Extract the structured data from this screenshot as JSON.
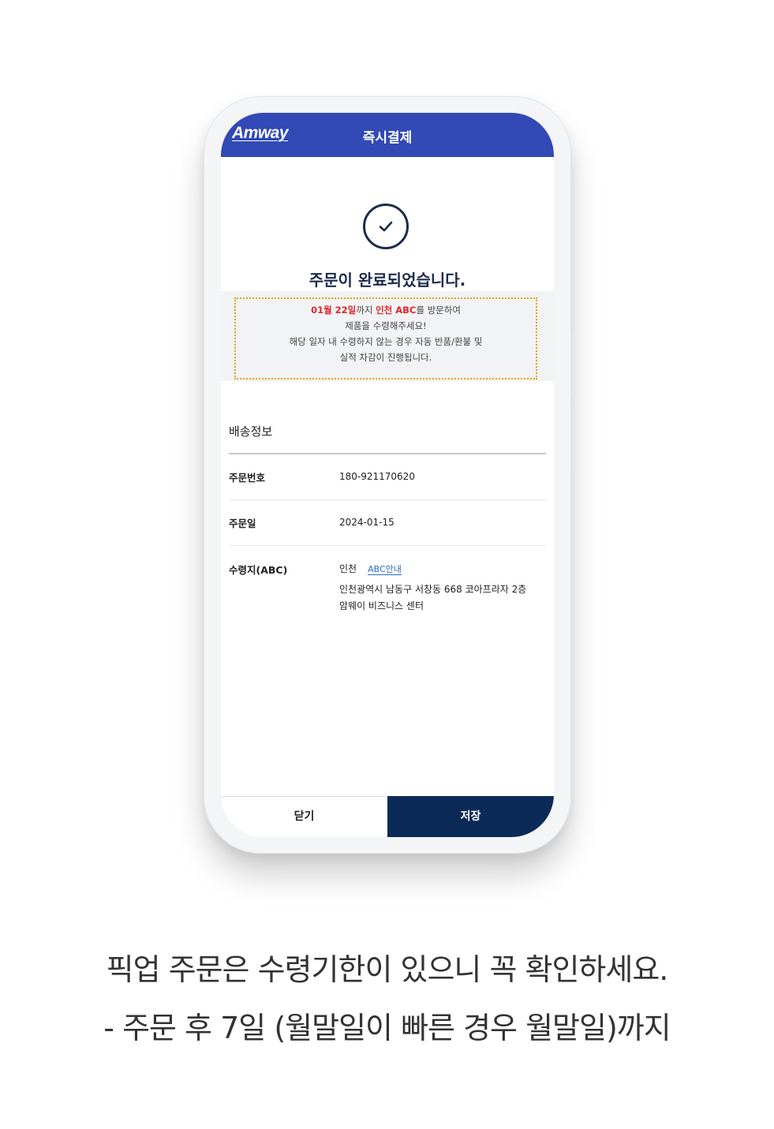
{
  "app": {
    "logo_text": "Amway",
    "title": "즉시결제"
  },
  "status": {
    "icon": "check-circle-icon",
    "title": "주문이 완료되었습니다."
  },
  "notice": {
    "line1_date": "01월 22일",
    "line1_mid": "까지 ",
    "line1_place": "인천 ABC",
    "line1_end": "를 방문하여",
    "line2": "제품을 수령해주세요!",
    "line3": "해당 일자 내 수령하지 않는 경우 자동 반품/환불 및",
    "line4": "실적 차감이 진행됩니다."
  },
  "shipping": {
    "section_title": "배송정보",
    "rows": [
      {
        "label": "주문번호",
        "value": "180-921170620"
      },
      {
        "label": "주문일",
        "value": "2024-01-15"
      },
      {
        "label": "수령지(ABC)",
        "value": "인천",
        "link": "ABC안내",
        "address_line1": "인천광역시 남동구 서창동 668 코아프라자 2층",
        "address_line2": "암웨이 비즈니스 센터"
      }
    ]
  },
  "buttons": {
    "close": "닫기",
    "save": "저장"
  },
  "caption": {
    "line1": "픽업 주문은 수령기한이 있으니 꼭 확인하세요.",
    "line2": "- 주문 후 7일 (월말일이 빠른 경우 월말일)까지"
  },
  "colors": {
    "header_blue": "#3249b6",
    "save_navy": "#0c2a57",
    "accent_red": "#e0262e",
    "notice_border": "#e8a20b",
    "link_blue": "#2b6cc4"
  }
}
